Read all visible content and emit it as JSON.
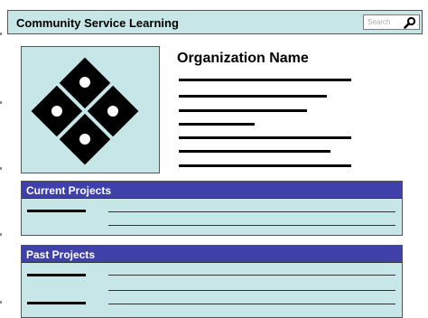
{
  "header": {
    "title": "Community Service Learning",
    "search_placeholder": "Search"
  },
  "organization": {
    "name": "Organization Name"
  },
  "sections": {
    "current_projects": {
      "title": "Current Projects"
    },
    "past_projects": {
      "title": "Past Projects"
    }
  },
  "colors": {
    "header_bg": "#c6e6e8",
    "panel_header_bg": "#3f41a8",
    "panel_bg": "#c6e6e8"
  }
}
